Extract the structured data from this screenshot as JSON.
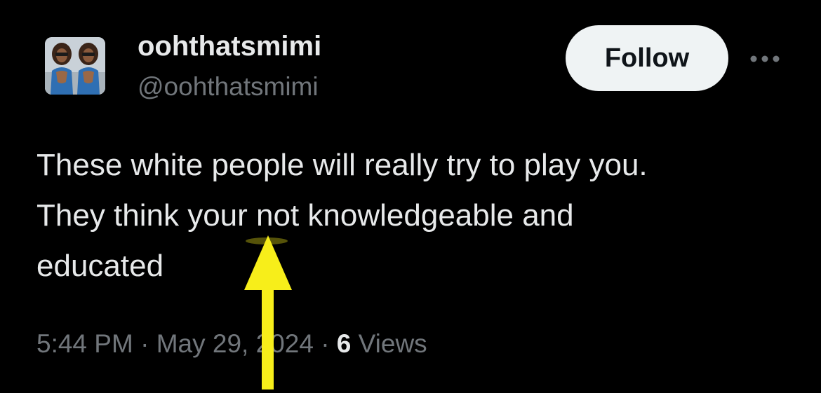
{
  "author": {
    "display_name": "oohthatsmimi",
    "handle": "@oohthatsmimi"
  },
  "actions": {
    "follow_label": "Follow",
    "more_icon": "more-horizontal-icon"
  },
  "tweet": {
    "lines": [
      "These white people will really try to play you.",
      "They think your not knowledgeable and",
      "educated"
    ]
  },
  "meta": {
    "time": "5:44 PM",
    "separator": "·",
    "date": "May 29, 2024",
    "views_count": "6",
    "views_label": "Views"
  },
  "annotation": {
    "icon": "arrow-up-icon",
    "color": "#f7ee1a"
  },
  "colors": {
    "background": "#000000",
    "text_primary": "#e7e9ea",
    "text_secondary": "#71767b",
    "follow_bg": "#eff3f4"
  }
}
